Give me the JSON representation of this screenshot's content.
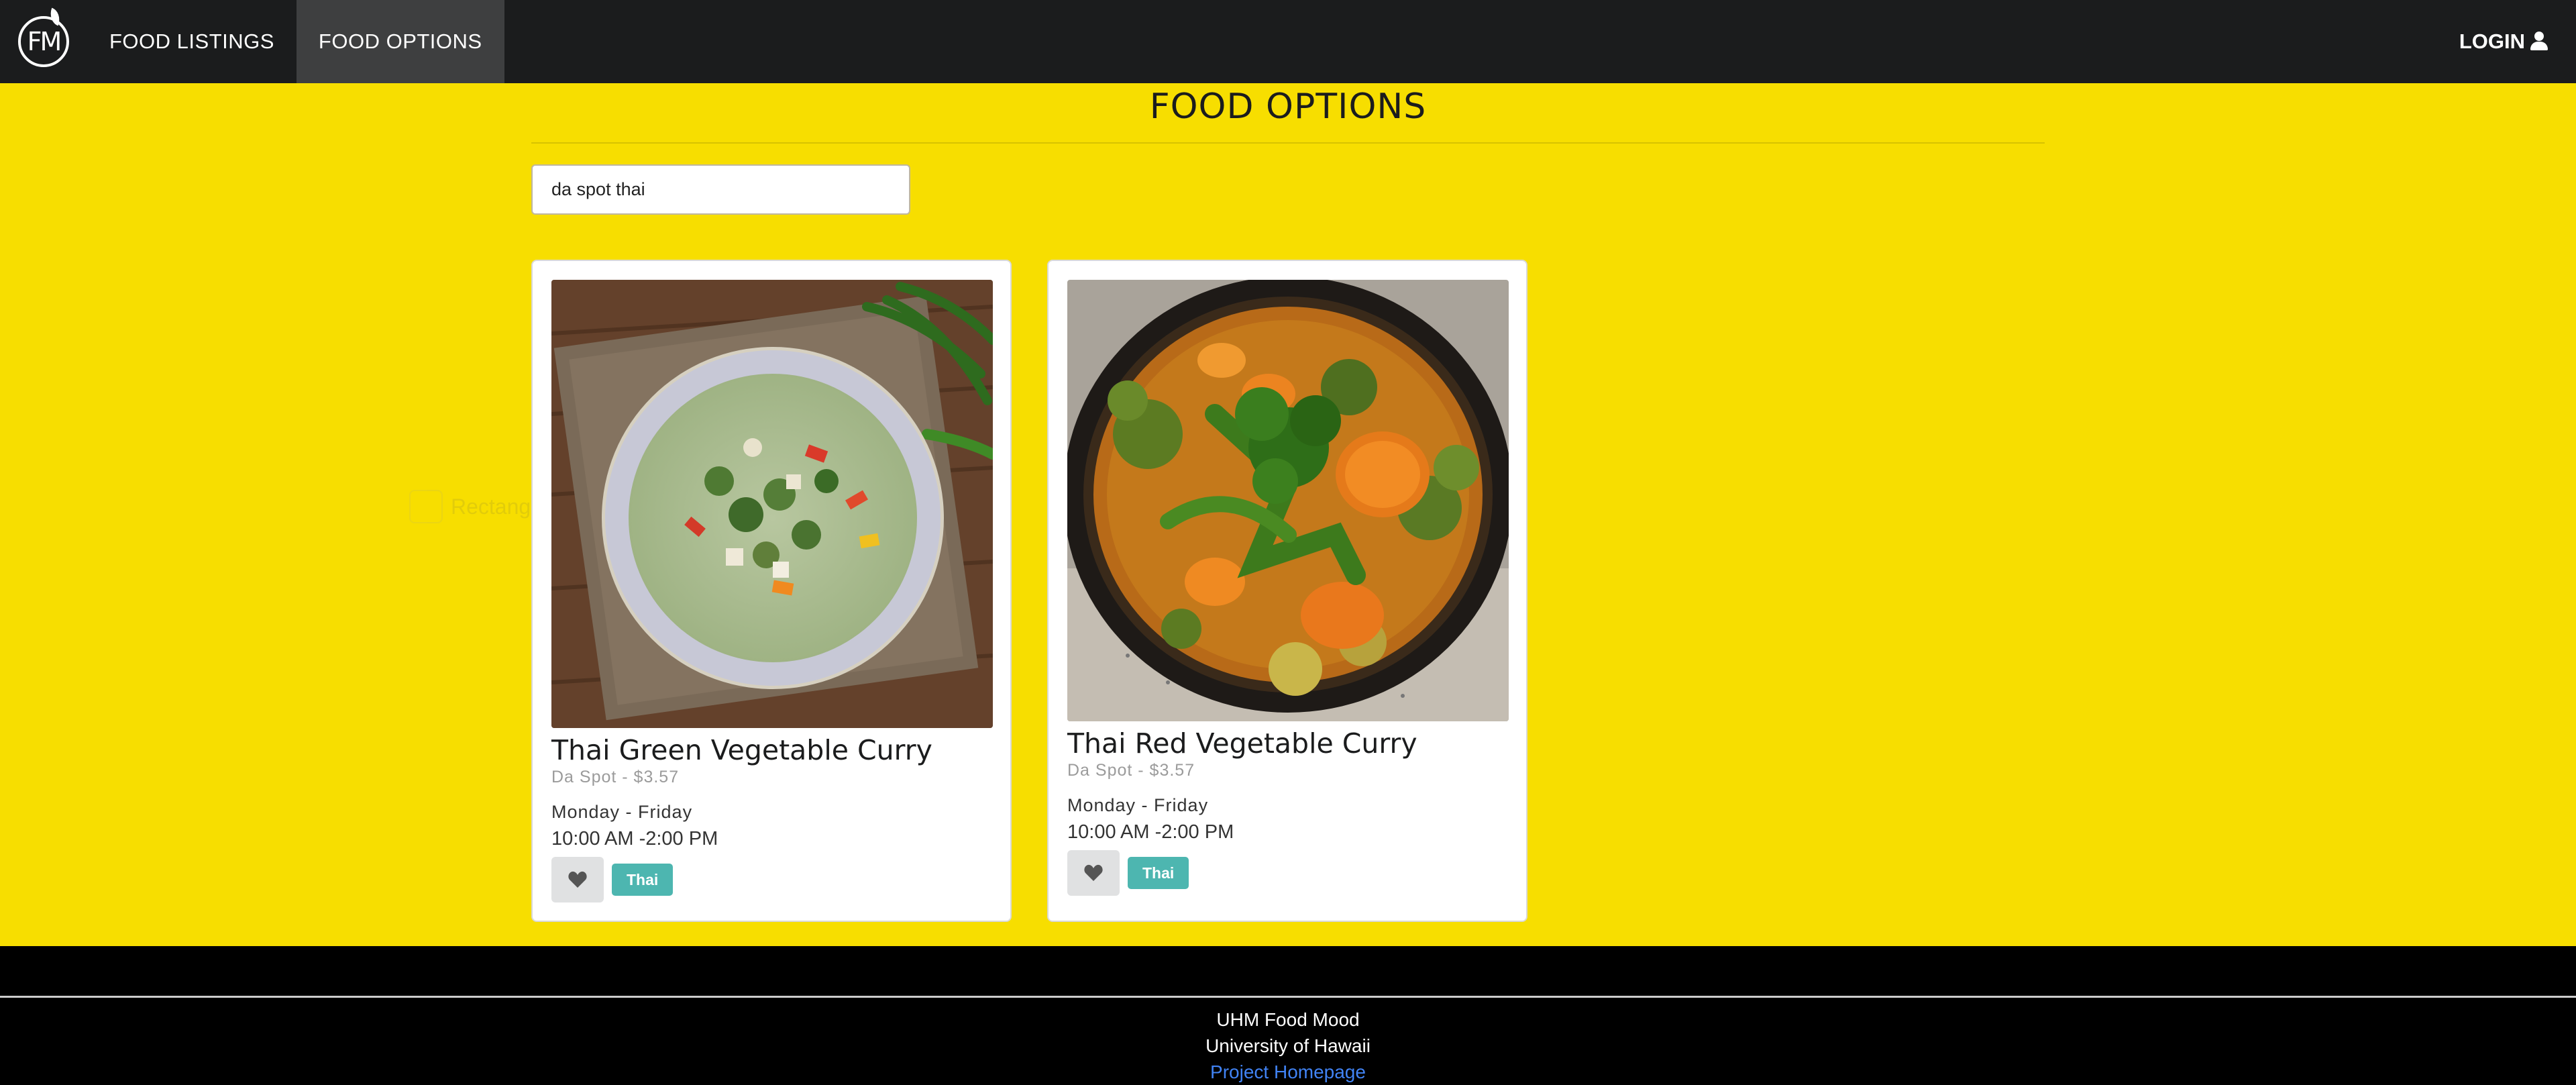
{
  "nav": {
    "logo_text": "FM",
    "items": [
      {
        "label": "FOOD LISTINGS",
        "active": false
      },
      {
        "label": "FOOD OPTIONS",
        "active": true
      }
    ],
    "login_label": "LOGIN",
    "login_icon": "user-icon"
  },
  "page": {
    "title": "FOOD OPTIONS",
    "search_value": "da spot thai"
  },
  "ghost_label": "Rectang",
  "cards": [
    {
      "name": "Thai Green Vegetable Curry",
      "vendor_price": "Da Spot - $3.57",
      "days": "Monday - Friday",
      "hours": "10:00 AM -2:00 PM",
      "tag": "Thai",
      "favorite_icon": "heart-icon"
    },
    {
      "name": "Thai Red Vegetable Curry",
      "vendor_price": "Da Spot - $3.57",
      "days": "Monday - Friday",
      "hours": "10:00 AM -2:00 PM",
      "tag": "Thai",
      "favorite_icon": "heart-icon"
    }
  ],
  "footer": {
    "line1": "UHM Food Mood",
    "line2": "University of Hawaii",
    "link": "Project Homepage"
  },
  "colors": {
    "background": "#f7de00",
    "navbar": "#1b1c1d",
    "tag": "#4db6b0",
    "link": "#4183f4"
  }
}
